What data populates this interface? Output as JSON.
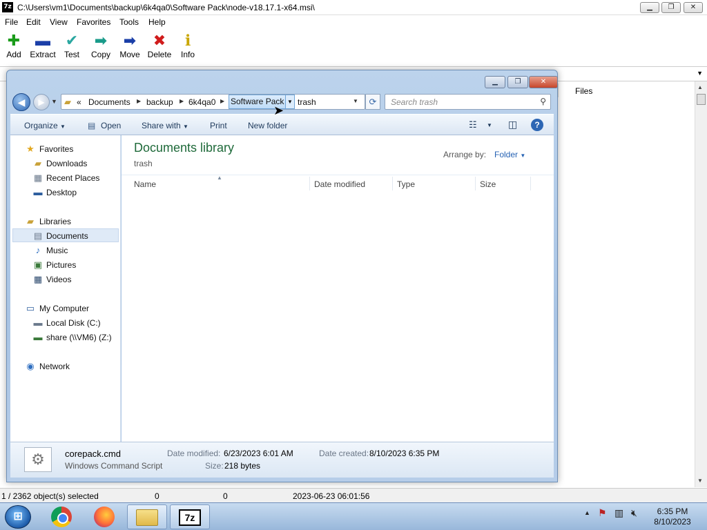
{
  "sevenzip": {
    "title": "C:\\Users\\vm1\\Documents\\backup\\6k4qa0\\Software Pack\\node-v18.17.1-x64.msi\\",
    "app_icon": "7z",
    "controls": {
      "minimize": "▁",
      "maximize": "❐",
      "close": "✕"
    },
    "menu": [
      "File",
      "Edit",
      "View",
      "Favorites",
      "Tools",
      "Help"
    ],
    "toolbar": [
      {
        "label": "Add",
        "icon": "plus-icon",
        "color": "#1a9b1a",
        "glyph": "✚"
      },
      {
        "label": "Extract",
        "icon": "minus-icon",
        "color": "#1b3fa8",
        "glyph": "▬"
      },
      {
        "label": "Test",
        "icon": "check-icon",
        "color": "#2aa7a0",
        "glyph": "✔"
      },
      {
        "label": "Copy",
        "icon": "copy-arrow-icon",
        "color": "#1a9b8a",
        "glyph": "➡"
      },
      {
        "label": "Move",
        "icon": "move-arrow-icon",
        "color": "#1b3fa8",
        "glyph": "➡"
      },
      {
        "label": "Delete",
        "icon": "delete-x-icon",
        "color": "#d01b1b",
        "glyph": "✖"
      },
      {
        "label": "Info",
        "icon": "info-icon",
        "color": "#c9a600",
        "glyph": "ℹ"
      }
    ],
    "list_header_files": "Files",
    "status": {
      "selection": "1 / 2362 object(s) selected",
      "size": "0",
      "packed": "0",
      "modified": "2023-06-23 06:01:56"
    }
  },
  "explorer": {
    "breadcrumb": [
      "«",
      "Documents",
      "backup",
      "6k4qa0",
      "Software Pack"
    ],
    "address_input": "trash",
    "search_placeholder": "Search trash",
    "commands": [
      "Organize",
      "Open",
      "Share with",
      "Print",
      "New folder"
    ],
    "nav": {
      "favorites": {
        "label": "Favorites",
        "items": [
          "Downloads",
          "Recent Places",
          "Desktop"
        ]
      },
      "libraries": {
        "label": "Libraries",
        "items": [
          "Documents",
          "Music",
          "Pictures",
          "Videos"
        ]
      },
      "computer": {
        "label": "My Computer",
        "items": [
          "Local Disk (C:)",
          "share (\\\\VM6) (Z:)"
        ]
      },
      "network": {
        "label": "Network"
      }
    },
    "library_title": "Documents library",
    "library_subtitle": "trash",
    "arrange_by_label": "Arrange by:",
    "arrange_by_value": "Folder",
    "columns": [
      "Name",
      "Date modified",
      "Type",
      "Size"
    ],
    "details": {
      "filename": "corepack.cmd",
      "filetype": "Windows Command Script",
      "modified_label": "Date modified:",
      "modified_value": "6/23/2023 6:01 AM",
      "size_label": "Size:",
      "size_value": "218 bytes",
      "created_label": "Date created:",
      "created_value": "8/10/2023 6:35 PM"
    }
  },
  "taskbar": {
    "apps": [
      "chrome-icon",
      "firefox-icon",
      "explorer-icon",
      "7zip-icon"
    ],
    "time": "6:35 PM",
    "date": "8/10/2023"
  }
}
